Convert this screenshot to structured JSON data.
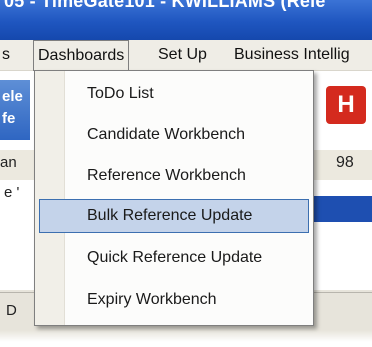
{
  "window": {
    "title": "05 - TimeGate101 - KWILLIAMS (Rele"
  },
  "menubar": {
    "items": [
      {
        "label": "s"
      },
      {
        "label": "Dashboards"
      },
      {
        "label": "Set Up"
      },
      {
        "label": "Business Intellig"
      }
    ]
  },
  "background": {
    "left_banner": "ele\nfe",
    "left_text_1": "an",
    "left_text_2": "e '",
    "right_badge": "H",
    "right_text": "98",
    "bottom_tab": "D"
  },
  "dropdown": {
    "items": [
      {
        "label": "ToDo List",
        "highlighted": false
      },
      {
        "label": "Candidate Workbench",
        "highlighted": false
      },
      {
        "label": "Reference Workbench",
        "highlighted": false
      },
      {
        "label": "Bulk Reference Update",
        "highlighted": true
      },
      {
        "label": "Quick Reference Update",
        "highlighted": false
      },
      {
        "label": "Expiry Workbench",
        "highlighted": false
      }
    ]
  },
  "colors": {
    "highlight_bg": "#c4d3ea",
    "highlight_border": "#3c6fb0",
    "titlebar": "#1f56c0"
  }
}
